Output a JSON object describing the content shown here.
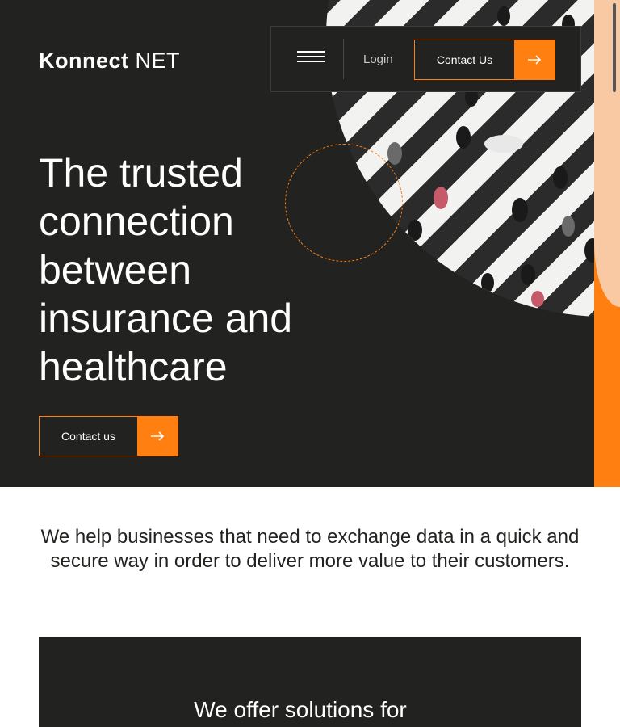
{
  "brand": {
    "logo_bold": "Konnect",
    "logo_thin": "NET"
  },
  "nav": {
    "menu_icon": "hamburger-icon",
    "login_label": "Login",
    "contact_label": "Contact Us",
    "arrow_icon": "arrow-right-icon"
  },
  "hero": {
    "headline": "The trusted connection between insurance and healthcare",
    "cta_label": "Contact us",
    "image": "aerial-crosswalk-pedestrians"
  },
  "intro": {
    "text": "We help businesses that need to exchange data in a quick and secure way in order to deliver more value to their customers."
  },
  "solutions": {
    "title": "We offer solutions for"
  },
  "colors": {
    "accent": "#ff7f11",
    "dark": "#222220",
    "peach": "#f8c9a2",
    "white": "#ffffff"
  }
}
